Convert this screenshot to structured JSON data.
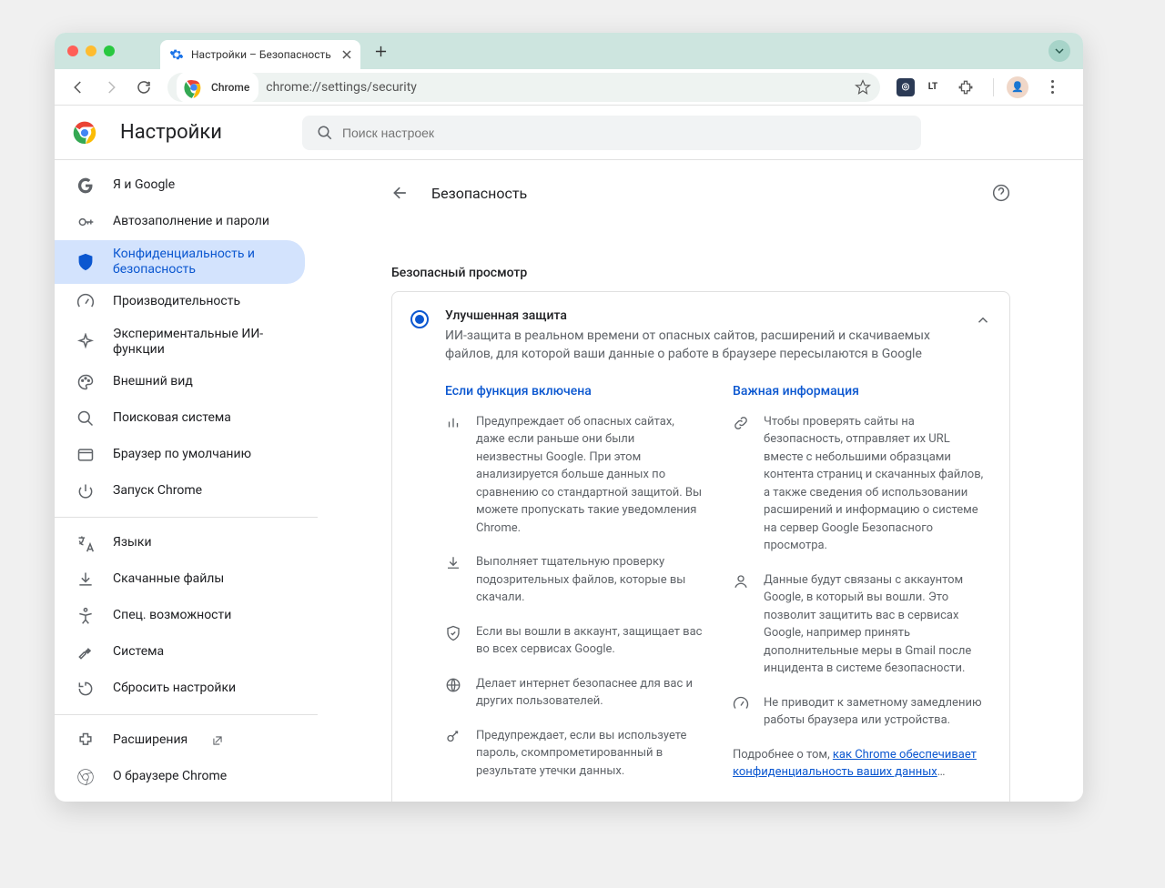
{
  "tab": {
    "title": "Настройки – Безопасность"
  },
  "toolbar": {
    "chrome_chip": "Chrome",
    "url": "chrome://settings/security"
  },
  "header": {
    "title": "Настройки",
    "search_placeholder": "Поиск настроек"
  },
  "sidebar": {
    "items": [
      {
        "label": "Я и Google"
      },
      {
        "label": "Автозаполнение и пароли"
      },
      {
        "label": "Конфиденциальность и безопасность"
      },
      {
        "label": "Производительность"
      },
      {
        "label": "Экспериментальные ИИ-функции"
      },
      {
        "label": "Внешний вид"
      },
      {
        "label": "Поисковая система"
      },
      {
        "label": "Браузер по умолчанию"
      },
      {
        "label": "Запуск Chrome"
      }
    ],
    "items2": [
      {
        "label": "Языки"
      },
      {
        "label": "Скачанные файлы"
      },
      {
        "label": "Спец. возможности"
      },
      {
        "label": "Система"
      },
      {
        "label": "Сбросить настройки"
      }
    ],
    "items3": [
      {
        "label": "Расширения"
      },
      {
        "label": "О браузере Chrome"
      }
    ]
  },
  "content": {
    "page_heading": "Безопасность",
    "section_title": "Безопасный просмотр",
    "option": {
      "title": "Улучшенная защита",
      "desc": "ИИ-защита в реальном времени от опасных сайтов, расширений и скачиваемых файлов, для которой ваши данные о работе в браузере пересылаются в Google"
    },
    "col1_title": "Если функция включена",
    "col2_title": "Важная информация",
    "col1": [
      "Предупреждает об опасных сайтах, даже если раньше они были неизвестны Google. При этом анализируется больше данных по сравнению со стандартной защитой. Вы можете пропускать такие уведомления Chrome.",
      "Выполняет тщательную проверку подозрительных файлов, которые вы скачали.",
      "Если вы вошли в аккаунт, защищает вас во всех сервисах Google.",
      "Делает интернет безопаснее для вас и других пользователей.",
      "Предупреждает, если вы используете пароль, скомпрометированный в результате утечки данных."
    ],
    "col2": [
      "Чтобы проверять сайты на безопасность, отправляет их URL вместе с небольшими образцами контента страниц и скачанных файлов, а также сведения об использовании расширений и информацию о системе на сервер Google Безопасного просмотра.",
      "Данные будут связаны с аккаунтом Google, в который вы вошли. Это позволит защитить вас в сервисах Google, например принять дополнительные меры в Gmail после инцидента в системе безопасности.",
      "Не приводит к заметному замедлению работы браузера или устройства."
    ],
    "learn_prefix": "Подробнее о том, ",
    "learn_link": "как Chrome обеспечивает конфиденциальность ваших данных",
    "learn_suffix": "…"
  }
}
